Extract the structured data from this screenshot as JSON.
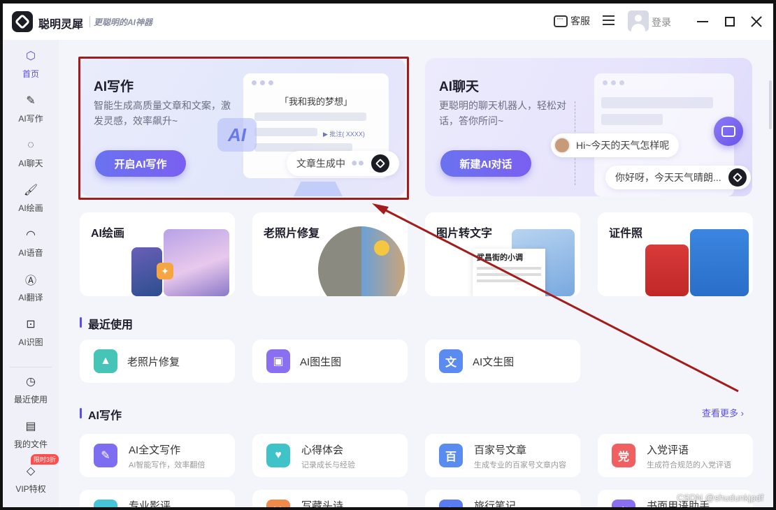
{
  "app": {
    "name": "聪明灵犀",
    "slogan": "更聪明的AI神器",
    "service_label": "客服",
    "login_label": "登录"
  },
  "sidebar": {
    "items": [
      {
        "label": "首页",
        "icon": "home-icon",
        "active": true
      },
      {
        "label": "AI写作",
        "icon": "pen-icon"
      },
      {
        "label": "AI聊天",
        "icon": "chat-icon"
      },
      {
        "label": "AI绘画",
        "icon": "brush-icon"
      },
      {
        "label": "AI语音",
        "icon": "headphones-icon"
      },
      {
        "label": "AI翻译",
        "icon": "translate-icon"
      },
      {
        "label": "AI识图",
        "icon": "scan-icon"
      },
      {
        "label": "最近使用",
        "icon": "clock-icon"
      },
      {
        "label": "我的文件",
        "icon": "file-icon"
      },
      {
        "label": "VIP特权",
        "icon": "diamond-icon"
      }
    ],
    "vip_badge": "限时3折"
  },
  "hero_write": {
    "title": "AI写作",
    "desc": "智能生成高质量文章和文案，激发灵感，效率飙升~",
    "button": "开启AI写作",
    "mock_heading": "「我和我的梦想」",
    "mock_note": "▶ 批注( XXXX)",
    "ai_badge": "AI",
    "bubble": "文章生成中"
  },
  "hero_chat": {
    "title": "AI聊天",
    "desc": "更聪明的聊天机器人，轻松对话，答你所问~",
    "button": "新建AI对话",
    "user_msg": "Hi~今天的天气怎样呢",
    "bot_msg": "你好呀，今天天气晴朗..."
  },
  "tiles": [
    {
      "title": "AI绘画"
    },
    {
      "title": "老照片修复"
    },
    {
      "title": "图片转文字",
      "doc_title": "武昌街的小调"
    },
    {
      "title": "证件照"
    }
  ],
  "recent": {
    "title": "最近使用",
    "items": [
      {
        "label": "老照片修复",
        "color": "#46c4b8"
      },
      {
        "label": "AI图生图",
        "color": "#8a6ff0"
      },
      {
        "label": "AI文生图",
        "color": "#5b8af0"
      }
    ]
  },
  "writing": {
    "title": "AI写作",
    "more": "查看更多 ›",
    "items": [
      {
        "title": "AI全文写作",
        "sub": "AI智能写作，效率翻倍",
        "icon_text": "✎",
        "color": "#7d6df0"
      },
      {
        "title": "心得体会",
        "sub": "记录成长与经验",
        "icon_text": "♥",
        "color": "#3fc2c8"
      },
      {
        "title": "百家号文章",
        "sub": "生成专业的百家号文章内容",
        "icon_text": "百",
        "color": "#5a8cf0"
      },
      {
        "title": "入党评语",
        "sub": "生成符合规范的入党评语",
        "icon_text": "党",
        "color": "#f06060"
      },
      {
        "title": "专业影评",
        "color": "#46c4d8"
      },
      {
        "title": "写藏头诗",
        "color": "#f08a4a"
      },
      {
        "title": "旅行笔记",
        "color": "#5a7cf0"
      },
      {
        "title": "书面用语助手",
        "color": "#8a6ff0"
      }
    ]
  },
  "watermark": "CSDN @shudunkjpdf"
}
